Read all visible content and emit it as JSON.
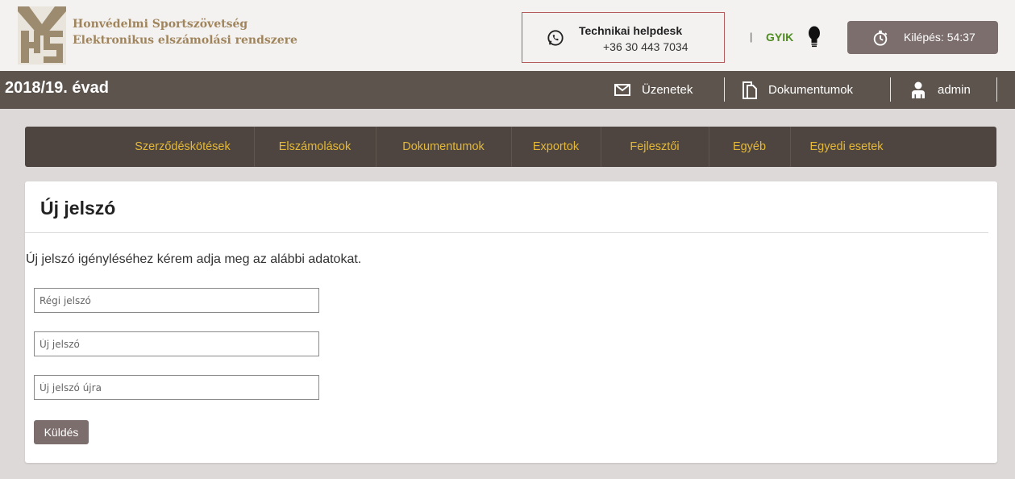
{
  "header": {
    "org_line1": "Honvédelmi Sportszövetség",
    "org_line2": "Elektronikus elszámolási rendszere",
    "helpdesk_title": "Technikai helpdesk",
    "helpdesk_phone": "+36 30 443 7034",
    "separator": "|",
    "gyik_label": "GYIK",
    "logout_label": "Kilépés: 54:37"
  },
  "season_bar": {
    "season": "2018/19. évad",
    "messages_label": "Üzenetek",
    "documents_label": "Dokumentumok",
    "user_label": "admin"
  },
  "nav": {
    "items": [
      "Szerződéskötések",
      "Elszámolások",
      "Dokumentumok",
      "Exportok",
      "Fejlesztői",
      "Egyéb",
      "Egyedi esetek"
    ]
  },
  "panel": {
    "title": "Új jelszó",
    "intro": "Új jelszó igényléséhez kérem adja meg az alábbi adatokat.",
    "old_password_placeholder": "Régi jelszó",
    "new_password_placeholder": "Új jelszó",
    "new_password_again_placeholder": "Új jelszó újra",
    "submit_label": "Küldés"
  },
  "colors": {
    "accent_brown": "#5d554d",
    "nav_bg": "#4e4540",
    "nav_text": "#e4b838",
    "button_bg": "#7d6e6e",
    "gyik_green": "#4e8c1f",
    "org_text": "#a0855c"
  },
  "icons": {
    "logo": "hs-logo",
    "phone": "whatsapp-phone-icon",
    "bulb": "lightbulb-icon",
    "timer": "stopwatch-icon",
    "mail": "envelope-icon",
    "docs": "documents-icon",
    "user": "user-icon"
  }
}
